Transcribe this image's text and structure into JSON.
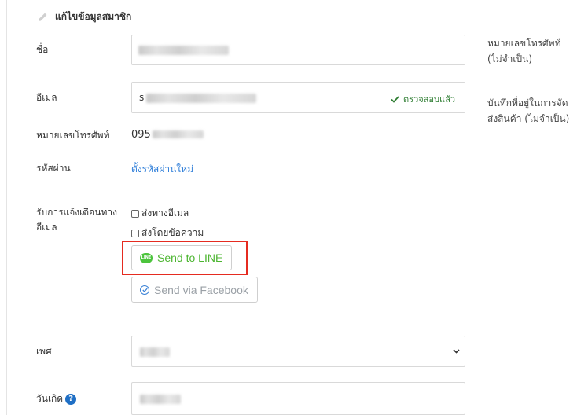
{
  "header": {
    "title": "แก้ไขข้อมูลสมาชิก",
    "icon": "pencil-icon"
  },
  "form": {
    "name": {
      "label": "ชื่อ"
    },
    "email": {
      "label": "อีเมล",
      "prefix": "s",
      "verified_text": "ตรวจสอบแล้ว"
    },
    "phone": {
      "label": "หมายเลขโทรศัพท์",
      "value": "095"
    },
    "password": {
      "label": "รหัสผ่าน",
      "link": "ตั้งรหัสผ่านใหม่"
    },
    "notify": {
      "label": "รับการแจ้งเตือนทางอีเมล",
      "opt_email": "ส่งทางอีเมล",
      "opt_sms": "ส่งโดยข้อความ",
      "line_button": "Send to LINE",
      "line_badge": "LINE",
      "facebook_button": "Send via Facebook"
    },
    "gender": {
      "label": "เพศ"
    },
    "birthday": {
      "label": "วันเกิด",
      "help": "?"
    }
  },
  "right_column": {
    "phone_optional": "หมายเลขโทรศัพท์ (ไม่จำเป็น)",
    "address_optional": "บันทึกที่อยู่ในการจัดส่งสินค้า (ไม่จำเป็น)"
  },
  "colors": {
    "accent_link": "#2a7bd8",
    "line_green": "#4cb530",
    "highlight_red": "#e52b20",
    "verified_green": "#2e7d32"
  }
}
